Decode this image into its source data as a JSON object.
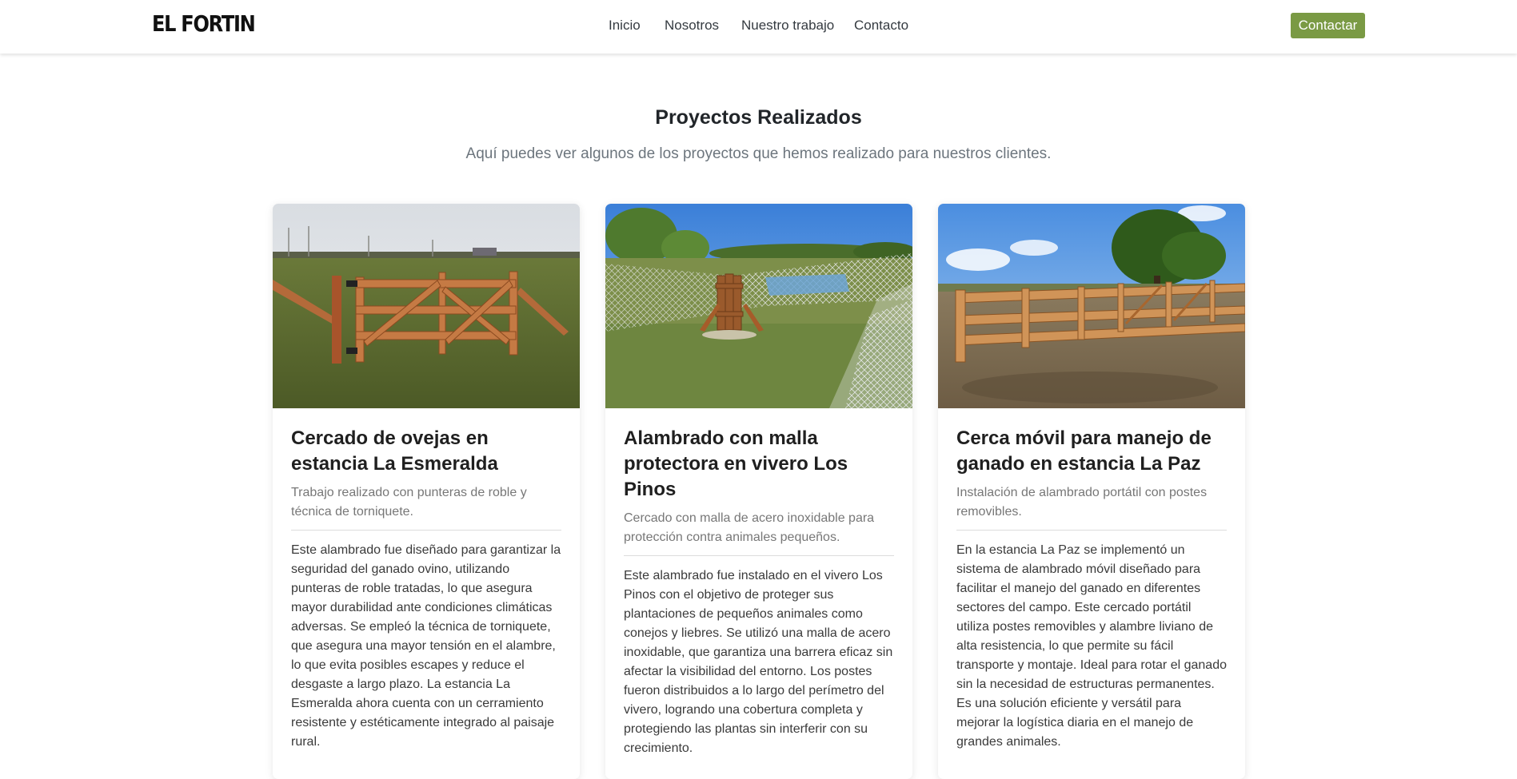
{
  "brand": "EL FORTIN",
  "nav": {
    "links": [
      "Inicio",
      "Nosotros",
      "Nuestro trabajo",
      "Contacto"
    ],
    "cta": "Contactar"
  },
  "colors": {
    "accent": "#7a9a44"
  },
  "section": {
    "title": "Proyectos Realizados",
    "subtitle": "Aquí puedes ver algunos de los proyectos que hemos realizado para nuestros clientes."
  },
  "projects": [
    {
      "title": "Cercado de ovejas en estancia La Esmeralda",
      "subtitle": "Trabajo realizado con punteras de roble y técnica de torniquete.",
      "description": "Este alambrado fue diseñado para garantizar la seguridad del ganado ovino, utilizando punteras de roble tratadas, lo que asegura mayor durabilidad ante condiciones climáticas adversas. Se empleó la técnica de torniquete, que asegura una mayor tensión en el alambre, lo que evita posibles escapes y reduce el desgaste a largo plazo. La estancia La Esmeralda ahora cuenta con un cerramiento resistente y estéticamente integrado al paisaje rural."
    },
    {
      "title": "Alambrado con malla protectora en vivero Los Pinos",
      "subtitle": "Cercado con malla de acero inoxidable para protección contra animales pequeños.",
      "description": "Este alambrado fue instalado en el vivero Los Pinos con el objetivo de proteger sus plantaciones de pequeños animales como conejos y liebres. Se utilizó una malla de acero inoxidable, que garantiza una barrera eficaz sin afectar la visibilidad del entorno. Los postes fueron distribuidos a lo largo del perímetro del vivero, logrando una cobertura completa y protegiendo las plantas sin interferir con su crecimiento."
    },
    {
      "title": "Cerca móvil para manejo de ganado en estancia La Paz",
      "subtitle": "Instalación de alambrado portátil con postes removibles.",
      "description": "En la estancia La Paz se implementó un sistema de alambrado móvil diseñado para facilitar el manejo del ganado en diferentes sectores del campo. Este cercado portátil utiliza postes removibles y alambre liviano de alta resistencia, lo que permite su fácil transporte y montaje. Ideal para rotar el ganado sin la necesidad de estructuras permanentes. Es una solución eficiente y versátil para mejorar la logística diaria en el manejo de grandes animales."
    }
  ]
}
